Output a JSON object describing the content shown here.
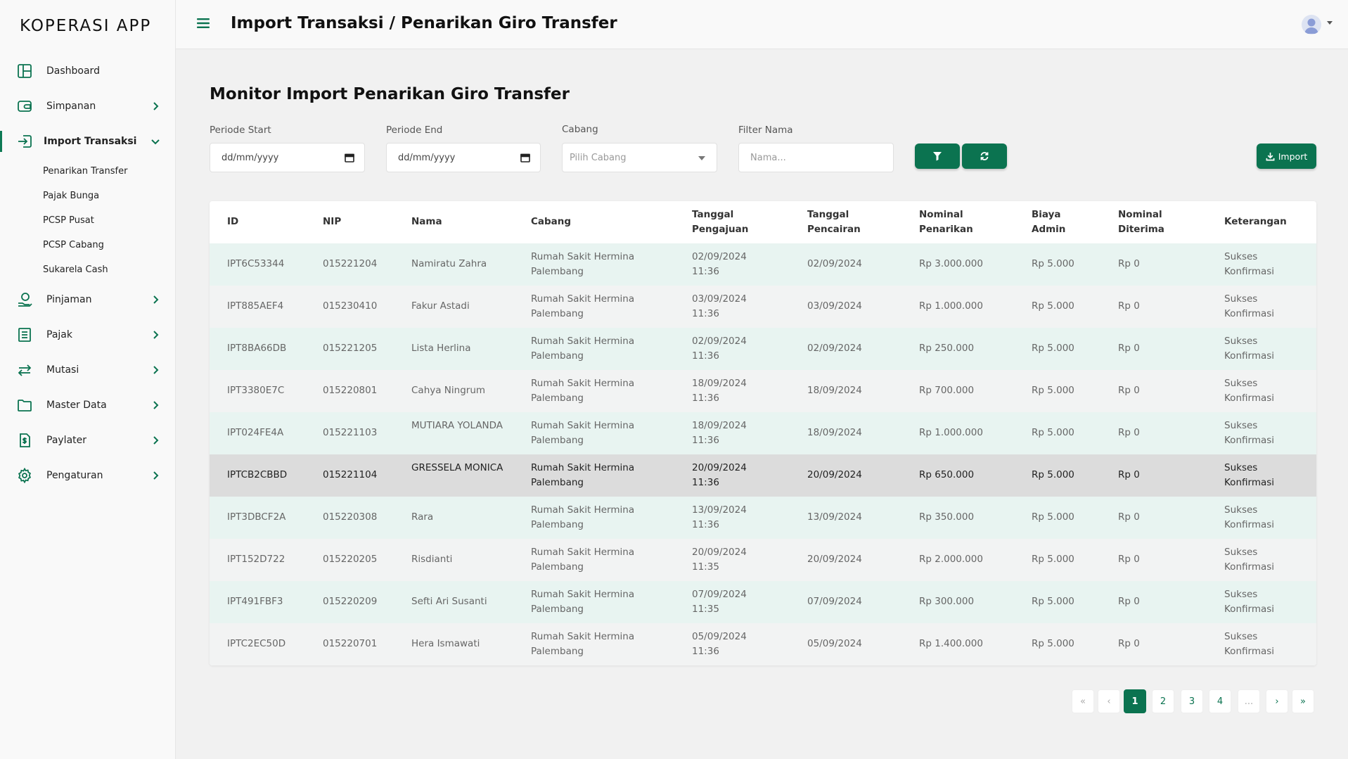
{
  "app": {
    "name": "KOPERASI APP"
  },
  "colors": {
    "accent": "#0b7350",
    "row_alt": "#e8f4f1",
    "row_highlight": "#dcdcdc"
  },
  "sidebar": {
    "items": [
      {
        "label": "Dashboard",
        "icon": "dashboard-icon"
      },
      {
        "label": "Simpanan",
        "icon": "wallet-icon"
      },
      {
        "label": "Import Transaksi",
        "icon": "import-icon"
      },
      {
        "label": "Pinjaman",
        "icon": "hand-coin-icon"
      },
      {
        "label": "Pajak",
        "icon": "receipt-icon"
      },
      {
        "label": "Mutasi",
        "icon": "swap-icon"
      },
      {
        "label": "Master Data",
        "icon": "folder-icon"
      },
      {
        "label": "Paylater",
        "icon": "dollar-doc-icon"
      },
      {
        "label": "Pengaturan",
        "icon": "gear-icon"
      }
    ],
    "import_sub": [
      "Penarikan Transfer",
      "Pajak Bunga",
      "PCSP Pusat",
      "PCSP Cabang",
      "Sukarela Cash"
    ]
  },
  "header": {
    "title": "Import Transaksi / Penarikan Giro Transfer"
  },
  "main": {
    "title": "Monitor Import Penarikan Giro Transfer",
    "filters": {
      "start_label": "Periode Start",
      "start_value": "dd/mm/yyyy",
      "end_label": "Periode End",
      "end_value": "dd/mm/yyyy",
      "branch_label": "Cabang",
      "branch_placeholder": "Pilih Cabang",
      "name_label": "Filter Nama",
      "name_placeholder": "Nama..."
    },
    "import_label": "Import"
  },
  "table": {
    "headers": [
      "ID",
      "NIP",
      "Nama",
      "Cabang",
      "Tanggal Pengajuan",
      "Tanggal Pencairan",
      "Nominal Penarikan",
      "Biaya Admin",
      "Nominal Diterima",
      "Keterangan"
    ],
    "rows": [
      {
        "id": "IPT6C53344",
        "nip": "015221204",
        "nama": "Namiratu Zahra",
        "cabang": "Rumah Sakit Hermina Palembang",
        "pengajuan": "02/09/2024 11:36",
        "pencairan": "02/09/2024",
        "nominal": "Rp 3.000.000",
        "biaya": "Rp 5.000",
        "diterima": "Rp 0",
        "ket": "Sukses Konfirmasi"
      },
      {
        "id": "IPT885AEF4",
        "nip": "015230410",
        "nama": "Fakur Astadi",
        "cabang": "Rumah Sakit Hermina Palembang",
        "pengajuan": "03/09/2024 11:36",
        "pencairan": "03/09/2024",
        "nominal": "Rp 1.000.000",
        "biaya": "Rp 5.000",
        "diterima": "Rp 0",
        "ket": "Sukses Konfirmasi"
      },
      {
        "id": "IPT8BA66DB",
        "nip": "015221205",
        "nama": "Lista Herlina",
        "cabang": "Rumah Sakit Hermina Palembang",
        "pengajuan": "02/09/2024 11:36",
        "pencairan": "02/09/2024",
        "nominal": "Rp 250.000",
        "biaya": "Rp 5.000",
        "diterima": "Rp 0",
        "ket": "Sukses Konfirmasi"
      },
      {
        "id": "IPT3380E7C",
        "nip": "015220801",
        "nama": "Cahya Ningrum",
        "cabang": "Rumah Sakit Hermina Palembang",
        "pengajuan": "18/09/2024 11:36",
        "pencairan": "18/09/2024",
        "nominal": "Rp 700.000",
        "biaya": "Rp 5.000",
        "diterima": "Rp 0",
        "ket": "Sukses Konfirmasi"
      },
      {
        "id": "IPT024FE4A",
        "nip": "015221103",
        "nama": "MUTIARA YOLANDA",
        "cabang": "Rumah Sakit Hermina Palembang",
        "pengajuan": "18/09/2024 11:36",
        "pencairan": "18/09/2024",
        "nominal": "Rp 1.000.000",
        "biaya": "Rp 5.000",
        "diterima": "Rp 0",
        "ket": "Sukses Konfirmasi"
      },
      {
        "id": "IPTCB2CBBD",
        "nip": "015221104",
        "nama": "GRESSELA MONICA",
        "cabang": "Rumah Sakit Hermina Palembang",
        "pengajuan": "20/09/2024 11:36",
        "pencairan": "20/09/2024",
        "nominal": "Rp 650.000",
        "biaya": "Rp 5.000",
        "diterima": "Rp 0",
        "ket": "Sukses Konfirmasi"
      },
      {
        "id": "IPT3DBCF2A",
        "nip": "015220308",
        "nama": "Rara",
        "cabang": "Rumah Sakit Hermina Palembang",
        "pengajuan": "13/09/2024 11:36",
        "pencairan": "13/09/2024",
        "nominal": "Rp 350.000",
        "biaya": "Rp 5.000",
        "diterima": "Rp 0",
        "ket": "Sukses Konfirmasi"
      },
      {
        "id": "IPT152D722",
        "nip": "015220205",
        "nama": "Risdianti",
        "cabang": "Rumah Sakit Hermina Palembang",
        "pengajuan": "20/09/2024 11:35",
        "pencairan": "20/09/2024",
        "nominal": "Rp 2.000.000",
        "biaya": "Rp 5.000",
        "diterima": "Rp 0",
        "ket": "Sukses Konfirmasi"
      },
      {
        "id": "IPT491FBF3",
        "nip": "015220209",
        "nama": "Sefti Ari Susanti",
        "cabang": "Rumah Sakit Hermina Palembang",
        "pengajuan": "07/09/2024 11:35",
        "pencairan": "07/09/2024",
        "nominal": "Rp 300.000",
        "biaya": "Rp 5.000",
        "diterima": "Rp 0",
        "ket": "Sukses Konfirmasi"
      },
      {
        "id": "IPTC2EC50D",
        "nip": "015220701",
        "nama": "Hera Ismawati",
        "cabang": "Rumah Sakit Hermina Palembang",
        "pengajuan": "05/09/2024 11:36",
        "pencairan": "05/09/2024",
        "nominal": "Rp 1.400.000",
        "biaya": "Rp 5.000",
        "diterima": "Rp 0",
        "ket": "Sukses Konfirmasi"
      }
    ],
    "highlighted_row": 5
  },
  "pagination": {
    "first": "«",
    "prev": "‹",
    "pages": [
      "1",
      "2",
      "3",
      "4"
    ],
    "ellipsis": "...",
    "next": "›",
    "last": "»",
    "current": "1"
  }
}
